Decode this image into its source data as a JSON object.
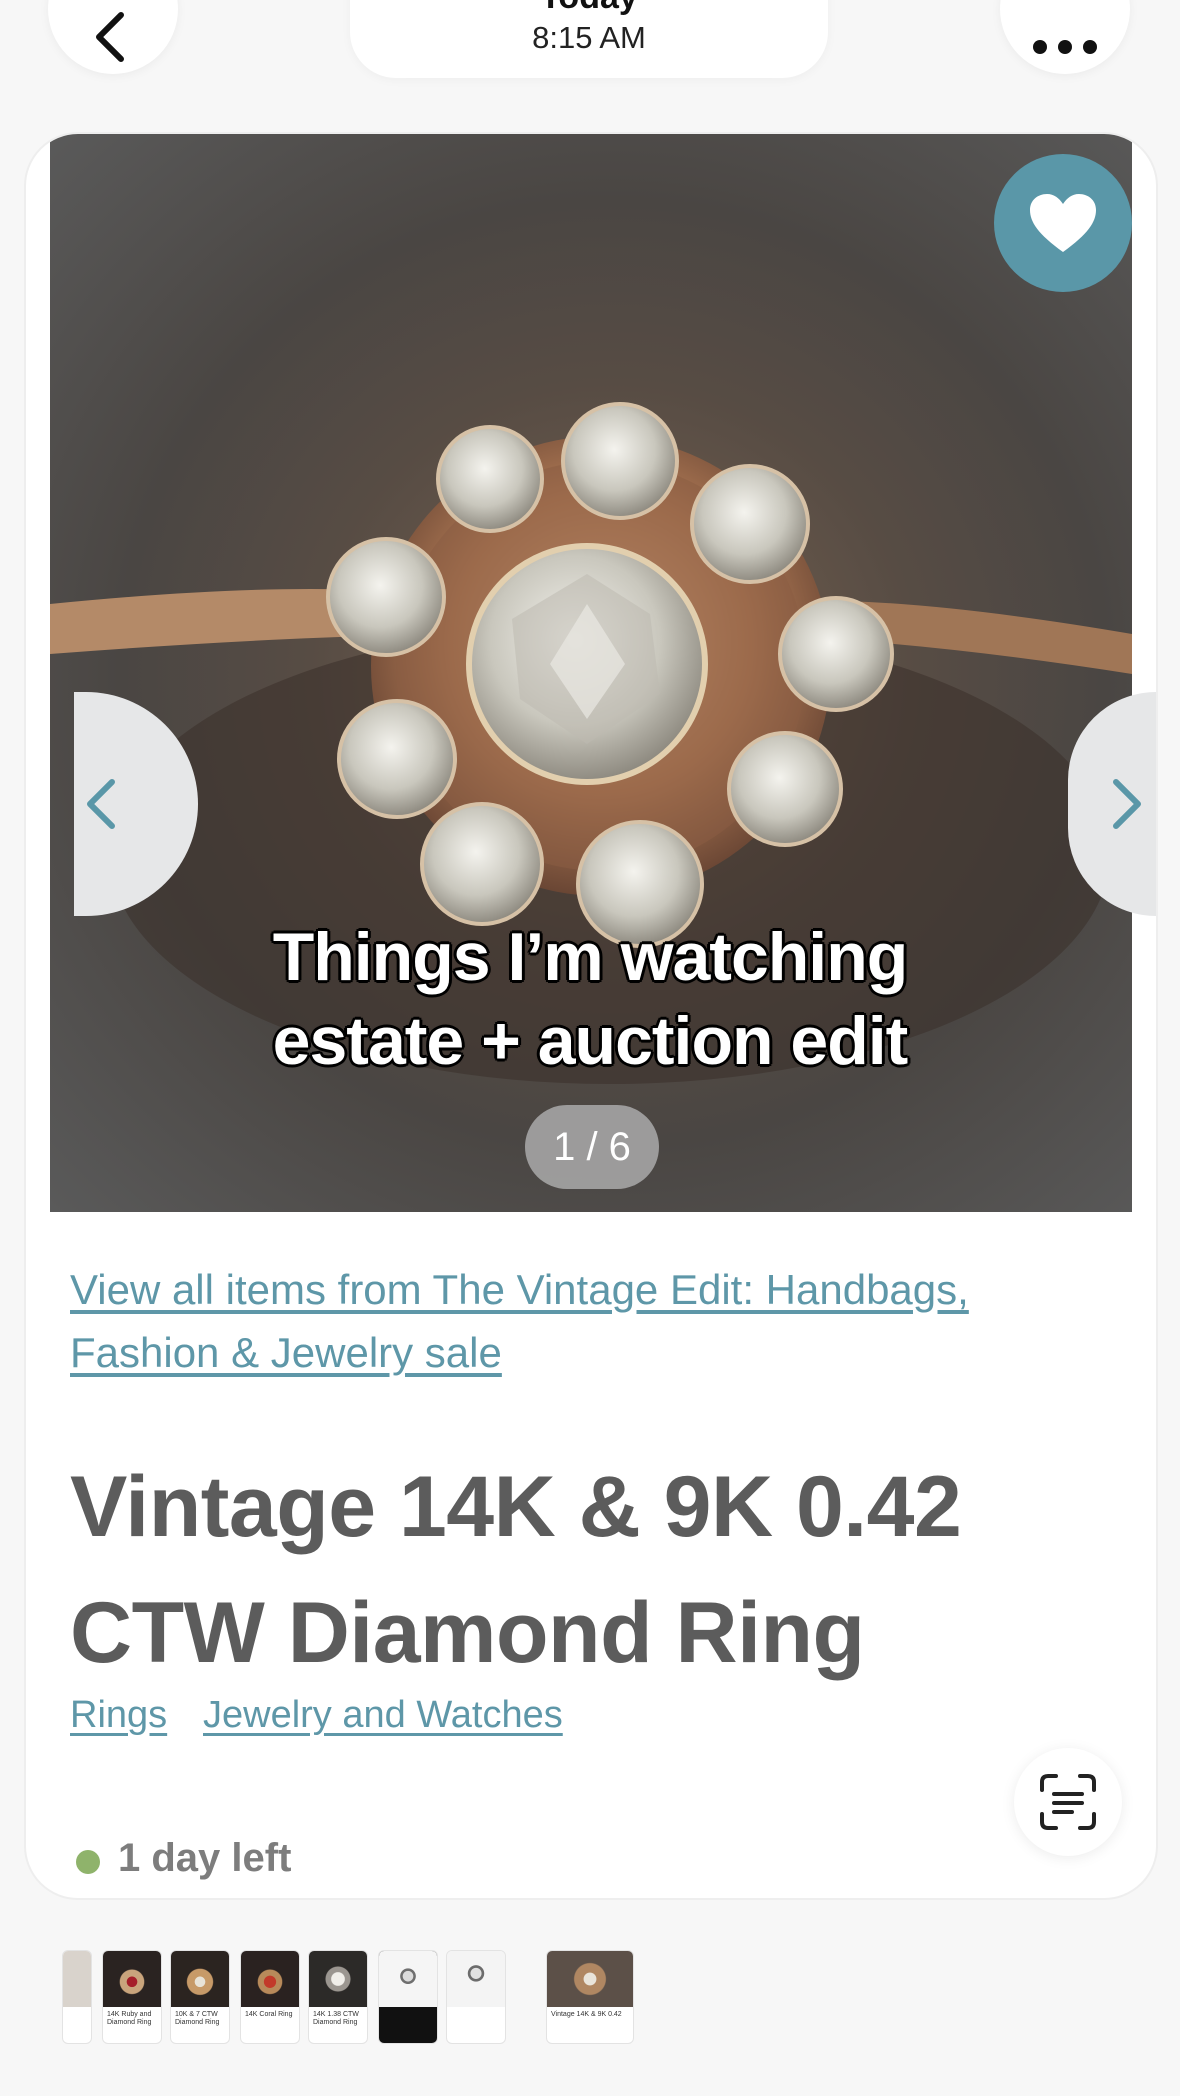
{
  "header": {
    "day_label": "Today",
    "time": "8:15 AM",
    "back_icon": "chevron-left-icon",
    "more_icon": "ellipsis-icon"
  },
  "listing": {
    "image_overlay_line1": "Things I’m watching",
    "image_overlay_line2": "estate + auction edit",
    "image_counter": "1 / 6",
    "favorite_icon": "heart-icon",
    "prev_icon": "chevron-left-icon",
    "next_icon": "chevron-right-icon",
    "sale_link": "View all items from The Vintage Edit: Handbags, Fashion & Jewelry sale",
    "title": "Vintage 14K & 9K 0.42 CTW Diamond Ring",
    "categories": [
      "Rings",
      "Jewelry and Watches"
    ],
    "time_left": "1 day left",
    "scan_icon": "scan-text-icon"
  },
  "thumbnails": [
    {
      "caption": ""
    },
    {
      "caption": "14K Ruby and Diamond Ring"
    },
    {
      "caption": "10K & 7 CTW Diamond Ring"
    },
    {
      "caption": "14K Coral Ring"
    },
    {
      "caption": "14K 1.38 CTW Diamond Ring"
    },
    {
      "caption": ""
    },
    {
      "caption": ""
    },
    {
      "caption": "Vintage 14K & 9K 0.42"
    }
  ],
  "colors": {
    "accent": "#5a97a8",
    "status_dot": "#8fb36b",
    "title_text": "#5c5c5c"
  }
}
